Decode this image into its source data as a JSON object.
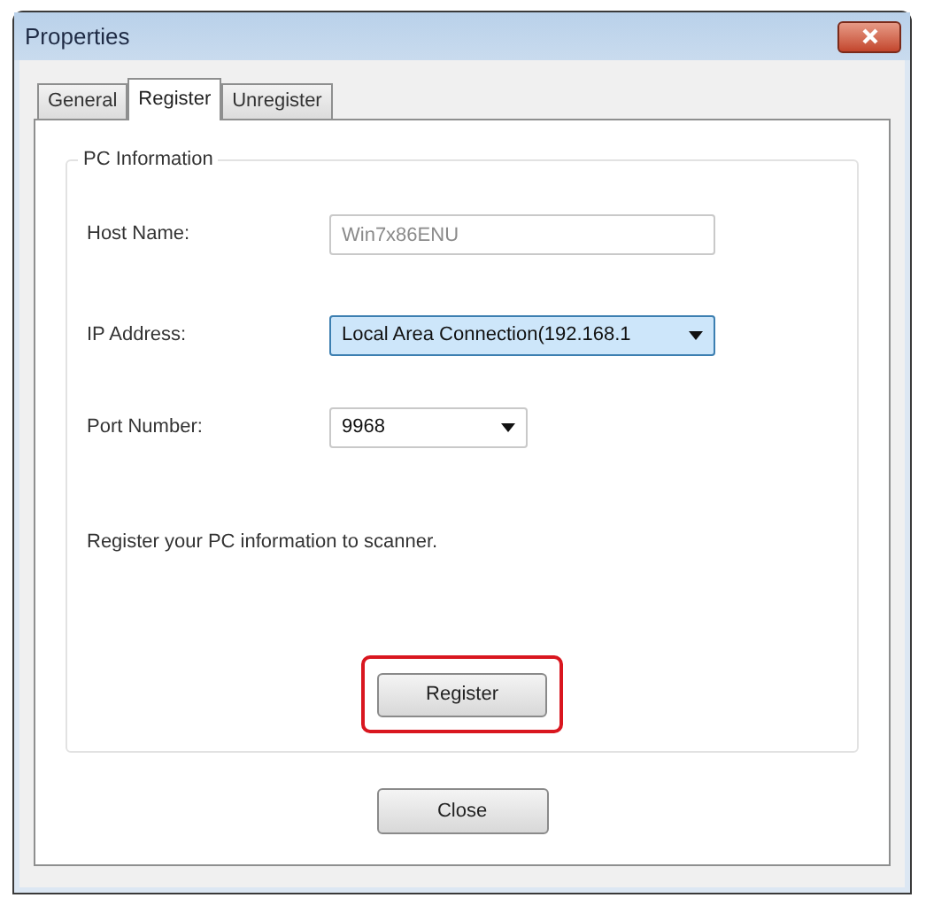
{
  "window": {
    "title": "Properties"
  },
  "tabs": [
    {
      "label": "General",
      "selected": false
    },
    {
      "label": "Register",
      "selected": true
    },
    {
      "label": "Unregister",
      "selected": false
    }
  ],
  "group": {
    "title": "PC Information",
    "fields": [
      {
        "kind": "text",
        "label": "Host Name:",
        "value": "Win7x86ENU",
        "disabled": true,
        "focused": false
      },
      {
        "kind": "dropdown",
        "label": "IP Address:",
        "value": "Local Area Connection(192.168.1",
        "disabled": false,
        "focused": true
      },
      {
        "kind": "dropdown",
        "label": "Port Number:",
        "value": "9968",
        "disabled": false,
        "focused": false
      }
    ],
    "message": "Register your PC information to scanner.",
    "button": {
      "label": "Register",
      "highlighted": true
    }
  },
  "buttons": [
    "Close"
  ]
}
